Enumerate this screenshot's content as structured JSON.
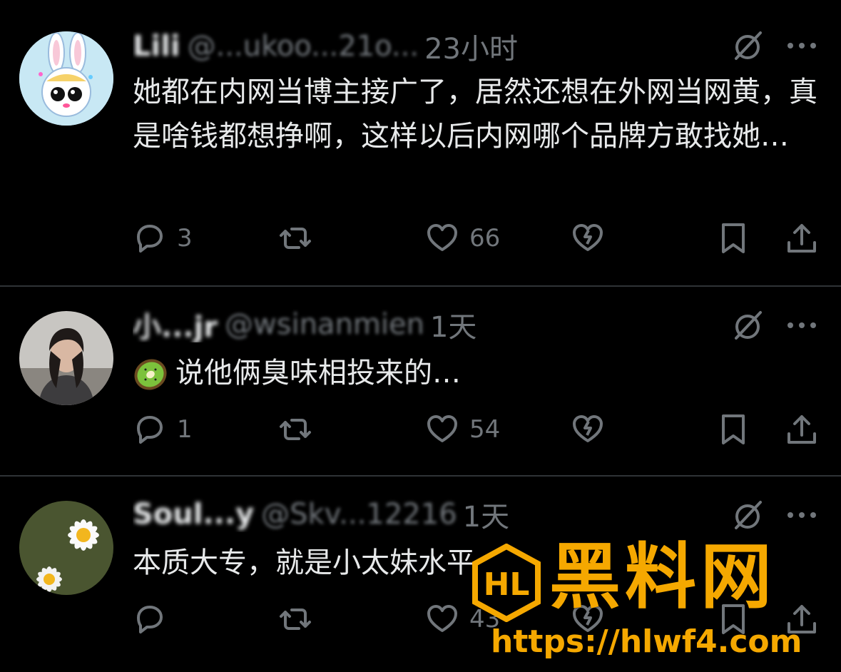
{
  "tweets": [
    {
      "name": "Lili",
      "handle": "@...ukoo...21o...",
      "time": "23小时",
      "text": "她都在内网当博主接广了，居然还想在外网当网黄，真是啥钱都想挣啊，这样以后内网哪个品牌方敢找她…",
      "replies": "3",
      "retweets": "",
      "likes": "66",
      "avatar_icon": "bunny-avatar"
    },
    {
      "name": "小...jr",
      "handle": "@wsinanmien",
      "time": "1天",
      "text": "说他俩臭味相投来的…",
      "emoji": "kiwi",
      "replies": "1",
      "retweets": "",
      "likes": "54",
      "avatar_icon": "woman-photo-avatar"
    },
    {
      "name": "Soul...y",
      "handle": "@Skv...12216",
      "time": "1天",
      "text": "本质大专，就是小太妹水平",
      "replies": "",
      "retweets": "",
      "likes": "43",
      "avatar_icon": "daisy-avatar"
    }
  ],
  "watermark": {
    "title": "黑料网",
    "url": "https://hlwf4.com",
    "logo_text": "HL"
  },
  "colors": {
    "background": "#000000",
    "text": "#e7e9ea",
    "muted": "#71767b",
    "divider": "#2f3336",
    "watermark": "#f5a800"
  }
}
